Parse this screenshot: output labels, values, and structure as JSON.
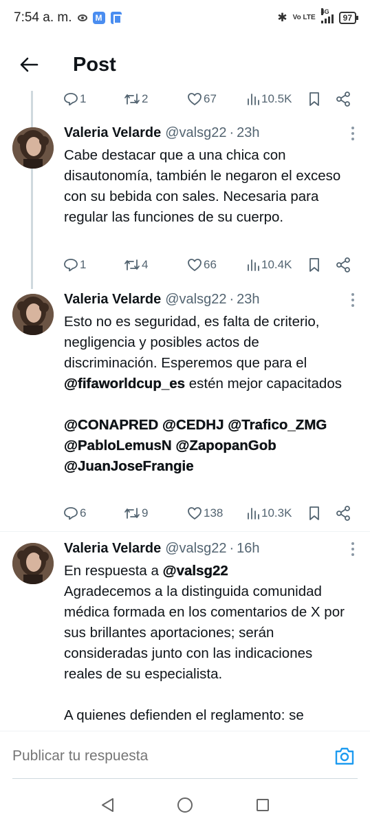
{
  "status_bar": {
    "time": "7:54 a. m.",
    "network_label": "Vo LTE",
    "network_type": "4G",
    "battery": "97"
  },
  "header": {
    "title": "Post"
  },
  "top_actions": {
    "replies": "1",
    "reposts": "2",
    "likes": "67",
    "views": "10.5K"
  },
  "tweets": [
    {
      "name": "Valeria Velarde",
      "handle": "@valsg22",
      "separator": "·",
      "time": "23h",
      "text": "Cabe destacar que a una chica con disautonomía, también le negaron el exceso con su bebida con sales. Necesaria para regular las funciones de su cuerpo.",
      "replies": "1",
      "reposts": "4",
      "likes": "66",
      "views": "10.4K"
    },
    {
      "name": "Valeria Velarde",
      "handle": "@valsg22",
      "separator": "·",
      "time": "23h",
      "text_part1": "Esto no es seguridad, es falta de criterio, negligencia y posibles actos de discriminación. Esperemos que para el",
      "mention_1": "@fifaworldcup_es",
      "text_part2": " estén mejor capacitados",
      "mentions_line1": [
        "@CONAPRED",
        "@CEDHJ",
        "@Trafico_ZMG"
      ],
      "mentions_line2": [
        "@PabloLemusN",
        "@ZapopanGob"
      ],
      "mentions_line3": [
        "@JuanJoseFrangie"
      ],
      "replies": "6",
      "reposts": "9",
      "likes": "138",
      "views": "10.3K"
    },
    {
      "name": "Valeria Velarde",
      "handle": "@valsg22",
      "separator": "·",
      "time": "16h",
      "reply_prefix": "En respuesta a ",
      "reply_to": "@valsg22",
      "text": "Agradecemos a la distinguida comunidad médica formada en los comentarios de X por sus brillantes aportaciones; serán consideradas junto con las indicaciones reales de su especialista.",
      "text2": "A quienes defienden el reglamento: se"
    }
  ],
  "composer": {
    "placeholder": "Publicar tu respuesta"
  },
  "colors": {
    "text": "#0f1419",
    "muted": "#536471",
    "accent": "#1d9bf0",
    "thread_line": "#cfd9de"
  }
}
